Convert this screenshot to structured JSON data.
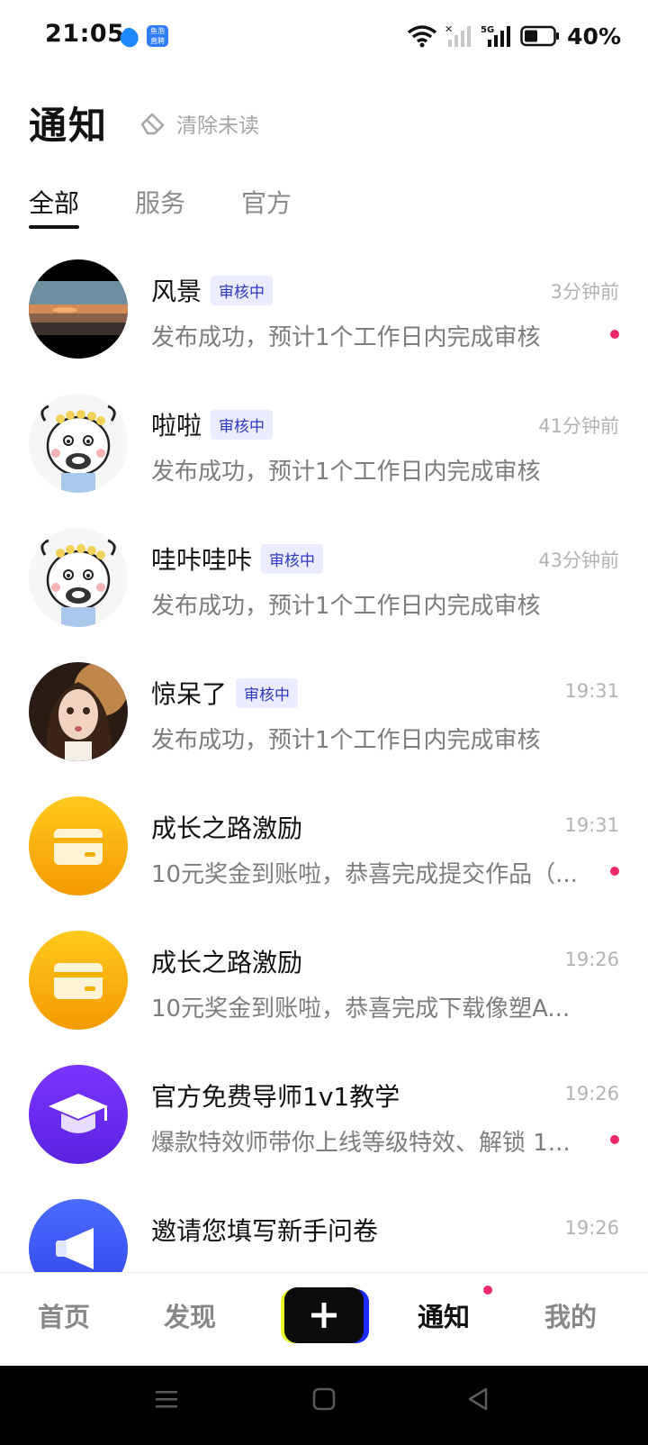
{
  "status_bar": {
    "time": "21:05",
    "app_icon_2_text": "鱼泡\n直聘",
    "battery": "40%"
  },
  "header": {
    "title": "通知",
    "clear_unread": "清除未读"
  },
  "tabs": [
    {
      "label": "全部",
      "active": true
    },
    {
      "label": "服务",
      "active": false
    },
    {
      "label": "官方",
      "active": false
    }
  ],
  "notifications": [
    {
      "title": "风景",
      "badge": "审核中",
      "time": "3分钟前",
      "desc": "发布成功，预计1个工作日内完成审核",
      "unread": true,
      "avatar": "landscape-photo"
    },
    {
      "title": "啦啦",
      "badge": "审核中",
      "time": "41分钟前",
      "desc": "发布成功，预计1个工作日内完成审核",
      "unread": false,
      "avatar": "cartoon-face"
    },
    {
      "title": "哇咔哇咔",
      "badge": "审核中",
      "time": "43分钟前",
      "desc": "发布成功，预计1个工作日内完成审核",
      "unread": false,
      "avatar": "cartoon-face"
    },
    {
      "title": "惊呆了",
      "badge": "审核中",
      "time": "19:31",
      "desc": "发布成功，预计1个工作日内完成审核",
      "unread": false,
      "avatar": "portrait-photo"
    },
    {
      "title": "成长之路激励",
      "badge": "",
      "time": "19:31",
      "desc": "10元奖金到账啦，恭喜完成提交作品（...",
      "unread": true,
      "avatar": "wallet-icon"
    },
    {
      "title": "成长之路激励",
      "badge": "",
      "time": "19:26",
      "desc": "10元奖金到账啦，恭喜完成下载像塑A...",
      "unread": false,
      "avatar": "wallet-icon"
    },
    {
      "title": "官方免费导师1v1教学",
      "badge": "",
      "time": "19:26",
      "desc": "爆款特效师带你上线等级特效、解锁 1...",
      "unread": true,
      "avatar": "graduation-cap-icon"
    },
    {
      "title": "邀请您填写新手问卷",
      "badge": "",
      "time": "19:26",
      "desc": "",
      "unread": false,
      "avatar": "megaphone-icon"
    }
  ],
  "bottom_nav": {
    "home": "首页",
    "discover": "发现",
    "notifications": "通知",
    "mine": "我的",
    "active": "通知"
  },
  "colors": {
    "accent_red": "#f0286a",
    "badge_text": "#2d39c4",
    "badge_bg": "#ebecff",
    "wallet_yellow": "#f9b400",
    "purple": "#6a2ff0"
  }
}
